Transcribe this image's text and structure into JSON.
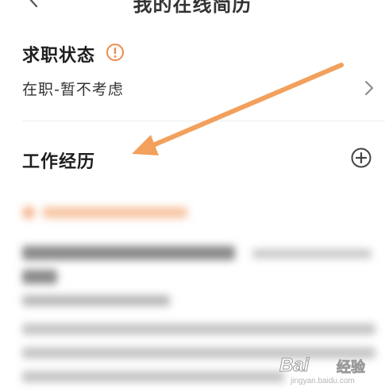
{
  "header": {
    "title": "我的在线简历",
    "back_icon": "chevron-left-icon"
  },
  "job_status": {
    "title": "求职状态",
    "value": "在职-暂不考虑",
    "warning_icon": "warning-circle-icon",
    "warning_color": "#F08A4B",
    "chevron_icon": "chevron-right-icon"
  },
  "work_history": {
    "title": "工作经历",
    "add_icon": "add-circle-icon"
  },
  "annotation": {
    "arrow_color": "#F2A05C"
  },
  "watermark": {
    "logo": "Bai",
    "text": "经验",
    "url": "jingyan.baidu.com"
  }
}
